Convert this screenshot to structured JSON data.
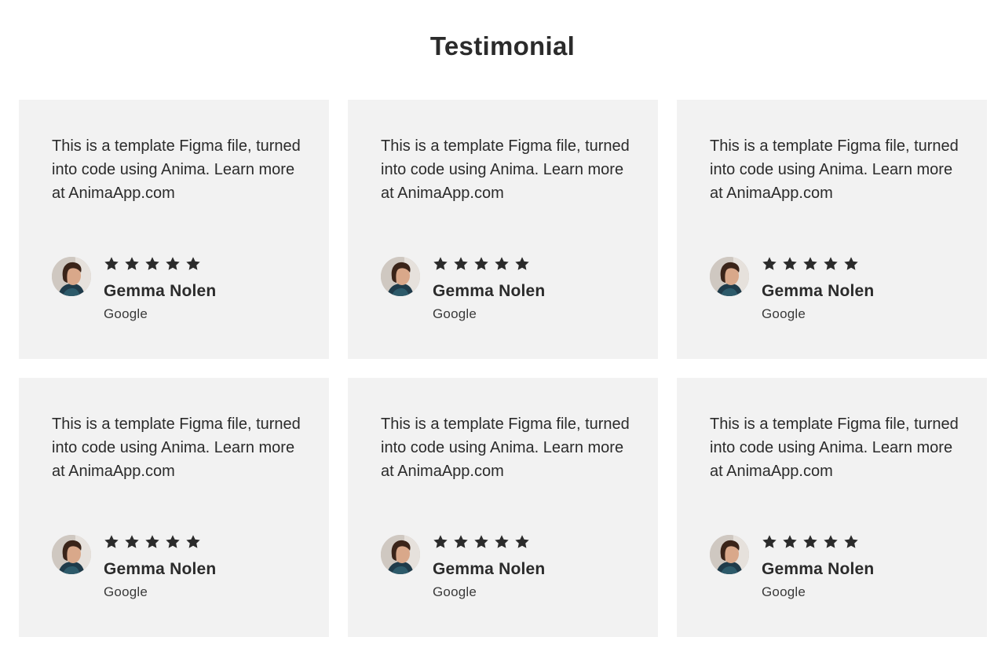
{
  "title": "Testimonial",
  "rating_icon": "star-icon",
  "colors": {
    "card_bg": "#f2f2f2",
    "text": "#2b2b2b"
  },
  "testimonials": [
    {
      "quote": "This is a template Figma file, turned into code using Anima. Learn more at AnimaApp.com",
      "rating": 5,
      "name": "Gemma Nolen",
      "company": "Google"
    },
    {
      "quote": "This is a template Figma file, turned into code using Anima. Learn more at AnimaApp.com",
      "rating": 5,
      "name": "Gemma Nolen",
      "company": "Google"
    },
    {
      "quote": "This is a template Figma file, turned into code using Anima. Learn more at AnimaApp.com",
      "rating": 5,
      "name": "Gemma Nolen",
      "company": "Google"
    },
    {
      "quote": "This is a template Figma file, turned into code using Anima. Learn more at AnimaApp.com",
      "rating": 5,
      "name": "Gemma Nolen",
      "company": "Google"
    },
    {
      "quote": "This is a template Figma file, turned into code using Anima. Learn more at AnimaApp.com",
      "rating": 5,
      "name": "Gemma Nolen",
      "company": "Google"
    },
    {
      "quote": "This is a template Figma file, turned into code using Anima. Learn more at AnimaApp.com",
      "rating": 5,
      "name": "Gemma Nolen",
      "company": "Google"
    }
  ]
}
